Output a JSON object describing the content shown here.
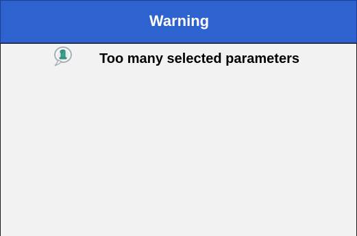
{
  "dialog": {
    "title": "Warning",
    "message": "Too many selected parameters",
    "icon": "info-speech-bubble-icon"
  },
  "colors": {
    "titlebar": "#2e62ce",
    "title_text": "#ffffff",
    "body_background": "#f2f2f2",
    "border": "#1a1a1a",
    "message_text": "#000000",
    "icon_accent": "#3aa58f"
  }
}
